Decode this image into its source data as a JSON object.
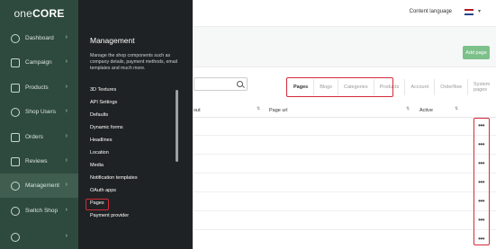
{
  "brand": {
    "prefix": "one",
    "name": "CORE"
  },
  "sidebar": {
    "items": [
      {
        "label": "Dashboard",
        "icon": "gauge-icon"
      },
      {
        "label": "Campaign",
        "icon": "calendar-icon"
      },
      {
        "label": "Products",
        "icon": "cart-icon"
      },
      {
        "label": "Shop Users",
        "icon": "users-icon"
      },
      {
        "label": "Orders",
        "icon": "list-icon"
      },
      {
        "label": "Reviews",
        "icon": "comment-icon"
      },
      {
        "label": "Management",
        "icon": "gear-icon",
        "active": true
      },
      {
        "label": "Switch Shop",
        "icon": "switch-icon"
      },
      {
        "label": "",
        "icon": "user-icon"
      }
    ]
  },
  "header": {
    "content_language": "Content language"
  },
  "page_actions": {
    "add_page": "Add page"
  },
  "tabs": [
    "Pages",
    "Blogs",
    "Categories",
    "Products",
    "Account",
    "Orderflow",
    "System pages"
  ],
  "table": {
    "columns": [
      "out",
      "Page url",
      "Active"
    ]
  },
  "management": {
    "title": "Management",
    "description": "Manage the shop components such as company details, payment methods, email templates and much more.",
    "items": [
      "3D Textures",
      "API Settings",
      "Defaults",
      "Dynamic forms",
      "Headlines",
      "Location",
      "Media",
      "Notification templates",
      "OAuth apps",
      "Pages",
      "Payment provider"
    ]
  },
  "colors": {
    "sidebar": "#2e4a3e",
    "panel": "#1f2224",
    "accent": "#7cc08a",
    "highlight": "#d32b3a"
  }
}
